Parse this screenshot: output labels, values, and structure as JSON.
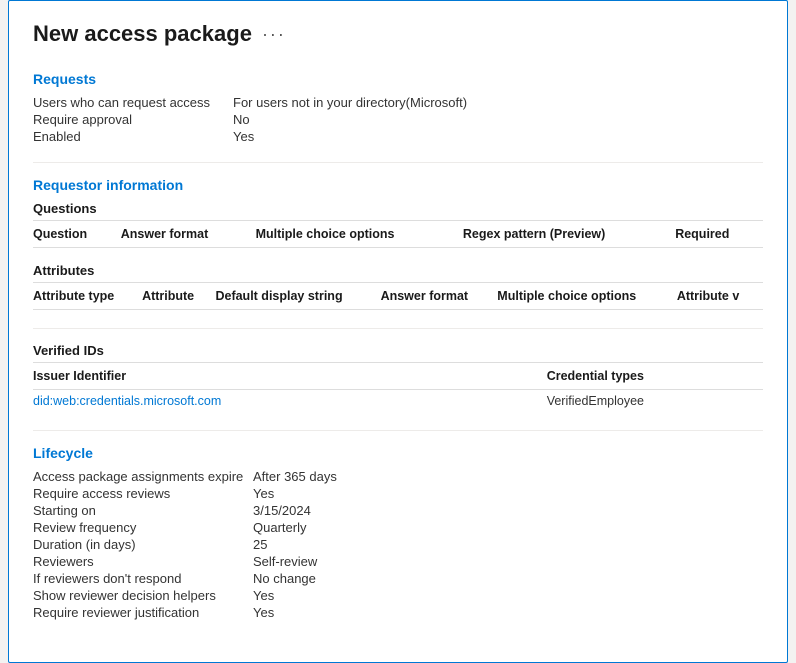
{
  "page": {
    "title": "New access package",
    "more_label": "···"
  },
  "requests": {
    "section_label": "Requests",
    "rows": [
      {
        "key": "Users who can request access",
        "value": "For users not in your directory(Microsoft)"
      },
      {
        "key": "Require approval",
        "value": "No"
      },
      {
        "key": "Enabled",
        "value": "Yes"
      }
    ]
  },
  "requestor_info": {
    "section_label": "Requestor information",
    "questions": {
      "title": "Questions",
      "columns": [
        "Question",
        "Answer format",
        "Multiple choice options",
        "Regex pattern (Preview)",
        "Required"
      ],
      "rows": []
    },
    "attributes": {
      "title": "Attributes",
      "columns": [
        "Attribute type",
        "Attribute",
        "Default display string",
        "Answer format",
        "Multiple choice options",
        "Attribute v"
      ],
      "rows": []
    }
  },
  "verified_ids": {
    "section_label": "Verified IDs",
    "columns": [
      "Issuer Identifier",
      "Credential types"
    ],
    "rows": [
      {
        "issuer": "did:web:credentials.microsoft.com",
        "cred_type": "VerifiedEmployee"
      }
    ]
  },
  "lifecycle": {
    "section_label": "Lifecycle",
    "rows": [
      {
        "key": "Access package assignments expire",
        "value": "After 365 days"
      },
      {
        "key": "Require access reviews",
        "value": "Yes"
      },
      {
        "key": "Starting on",
        "value": "3/15/2024"
      },
      {
        "key": "Review frequency",
        "value": "Quarterly"
      },
      {
        "key": "Duration (in days)",
        "value": "25"
      },
      {
        "key": "Reviewers",
        "value": "Self-review"
      },
      {
        "key": "If reviewers don't respond",
        "value": "No change"
      },
      {
        "key": "Show reviewer decision helpers",
        "value": "Yes"
      },
      {
        "key": "Require reviewer justification",
        "value": "Yes"
      }
    ]
  }
}
